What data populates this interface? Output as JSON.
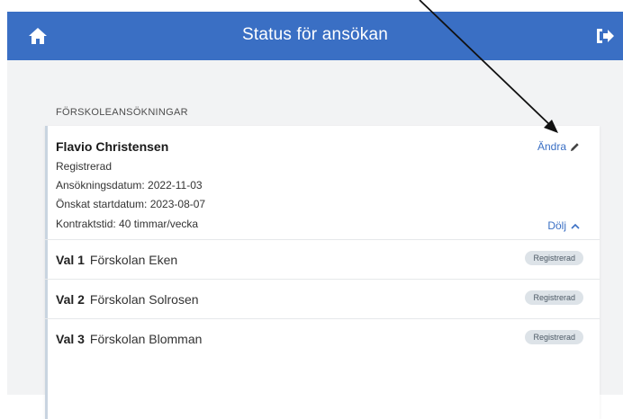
{
  "header": {
    "title": "Status för ansökan",
    "bg_color": "#3a6fc4",
    "home_icon": "home-icon",
    "logout_icon": "logout-icon"
  },
  "section": {
    "title": "FÖRSKOLEANSÖKNINGAR"
  },
  "application": {
    "name": "Flavio Christensen",
    "status": "Registrerad",
    "application_date": "Ansökningsdatum: 2022-11-03",
    "start_date": "Önskat startdatum: 2023-08-07",
    "contract_time": "Kontraktstid: 40 timmar/vecka",
    "edit_label": "Ändra",
    "edit_icon": "pencil-icon",
    "hide_label": "Dölj",
    "hide_icon": "chevron-up-icon",
    "choices": [
      {
        "label": "Val 1",
        "school": "Förskolan Eken",
        "status": "Registrerad"
      },
      {
        "label": "Val 2",
        "school": "Förskolan Solrosen",
        "status": "Registrerad"
      },
      {
        "label": "Val 3",
        "school": "Förskolan Blomman",
        "status": "Registrerad"
      }
    ]
  }
}
